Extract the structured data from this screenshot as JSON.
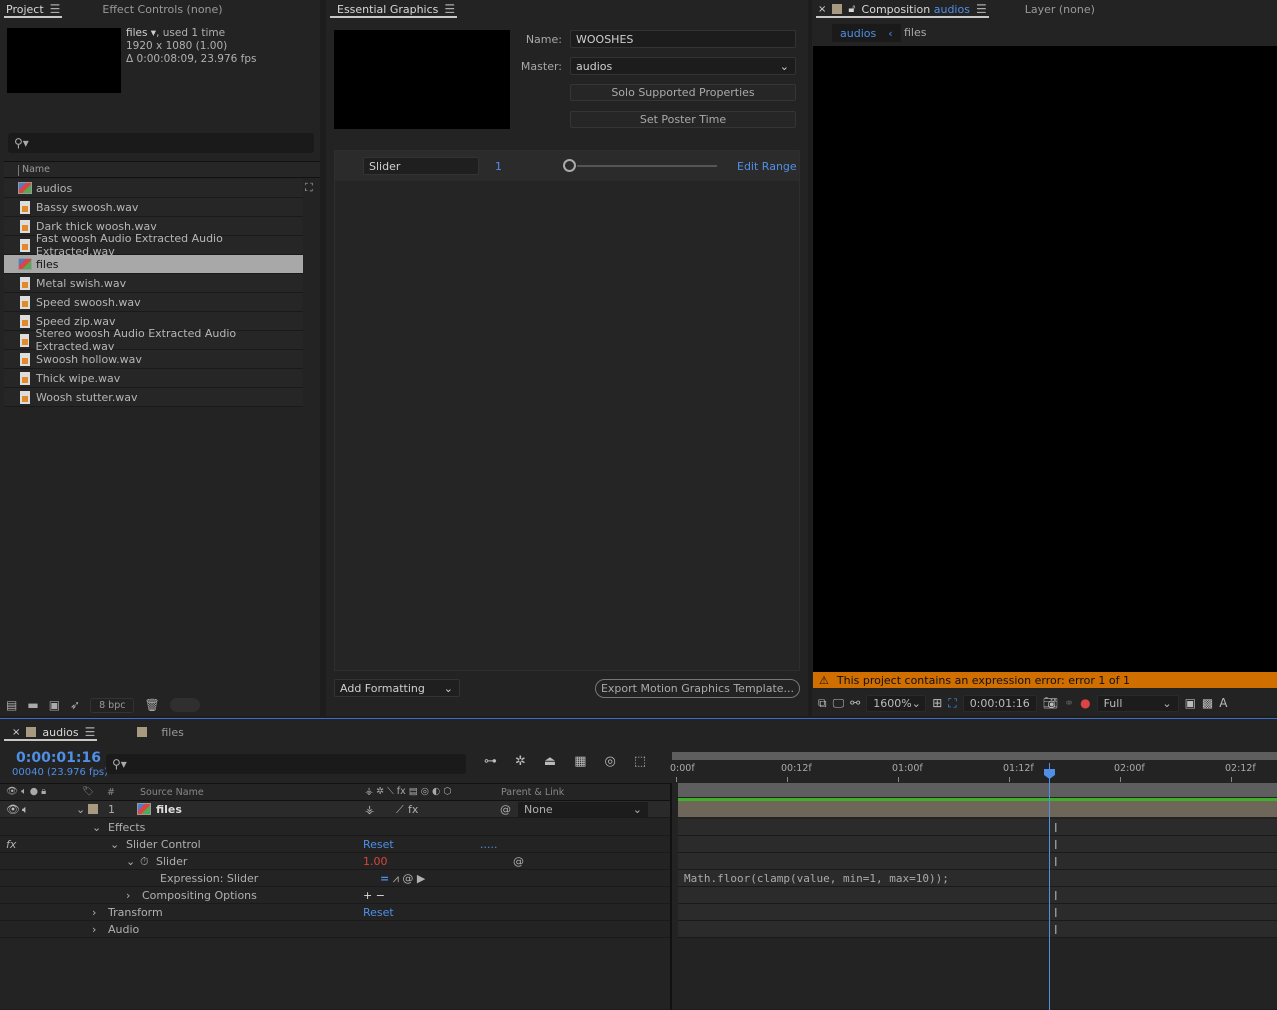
{
  "project": {
    "tabs": [
      {
        "label": "Project",
        "active": true
      },
      {
        "label": "Effect Controls (none)",
        "active": false
      }
    ],
    "info": {
      "name": "files",
      "usage": ", used 1 time",
      "resolution": "1920 x 1080 (1.00)",
      "duration": "Δ 0:00:08:09, 23.976 fps"
    },
    "search_placeholder": "",
    "column_name": "Name",
    "items": [
      {
        "name": "audios",
        "type": "comp",
        "selected": false
      },
      {
        "name": "Bassy swoosh.wav",
        "type": "audio",
        "selected": false
      },
      {
        "name": "Dark thick woosh.wav",
        "type": "audio",
        "selected": false
      },
      {
        "name": "Fast woosh Audio Extracted Audio Extracted.wav",
        "type": "audio",
        "selected": false
      },
      {
        "name": "files",
        "type": "comp",
        "selected": true
      },
      {
        "name": "Metal swish.wav",
        "type": "audio",
        "selected": false
      },
      {
        "name": "Speed swoosh.wav",
        "type": "audio",
        "selected": false
      },
      {
        "name": "Speed zip.wav",
        "type": "audio",
        "selected": false
      },
      {
        "name": "Stereo woosh Audio Extracted Audio Extracted.wav",
        "type": "audio",
        "selected": false
      },
      {
        "name": "Swoosh hollow.wav",
        "type": "audio",
        "selected": false
      },
      {
        "name": "Thick wipe.wav",
        "type": "audio",
        "selected": false
      },
      {
        "name": "Woosh stutter.wav",
        "type": "audio",
        "selected": false
      }
    ],
    "bpc": "8 bpc"
  },
  "essential": {
    "title": "Essential Graphics",
    "name_label": "Name:",
    "name_value": "WOOSHES",
    "master_label": "Master:",
    "master_value": "audios",
    "solo_button": "Solo Supported Properties",
    "poster_button": "Set Poster Time",
    "slider": {
      "name": "Slider",
      "value": "1",
      "edit_range": "Edit Range"
    },
    "add_formatting": "Add Formatting",
    "export_button": "Export Motion Graphics Template..."
  },
  "composition": {
    "tab_prefix": "Composition",
    "tab_name": "audios",
    "layer_tab": "Layer (none)",
    "breadcrumbs": [
      "audios",
      "files"
    ],
    "error": "This project contains an expression error: error 1 of 1",
    "zoom": "1600%",
    "timecode": "0:00:01:16",
    "resolution": "Full",
    "extra": "A"
  },
  "timeline": {
    "tabs": [
      {
        "label": "audios",
        "active": true
      },
      {
        "label": "files",
        "active": false
      }
    ],
    "timecode": "0:00:01:16",
    "frames": "00040 (23.976 fps)",
    "columns": {
      "num": "#",
      "source": "Source Name",
      "parent": "Parent & Link"
    },
    "layer": {
      "num": "1",
      "name": "files",
      "parent": "None"
    },
    "props": [
      {
        "label": "Effects",
        "value": ""
      },
      {
        "label": "Slider Control",
        "value": "Reset",
        "extra": "....."
      },
      {
        "label": "Slider",
        "value": "1.00"
      },
      {
        "label": "Expression: Slider",
        "value": ""
      },
      {
        "label": "Compositing Options",
        "value": "+ −"
      },
      {
        "label": "Transform",
        "value": "Reset"
      },
      {
        "label": "Audio",
        "value": ""
      }
    ],
    "ruler": [
      "0:00f",
      "00:12f",
      "01:00f",
      "01:12f",
      "02:00f",
      "02:12f"
    ],
    "expression": "Math.floor(clamp(value, min=1, max=10));"
  },
  "colors": {
    "accent": "#4f8fe6",
    "error": "#d16e00",
    "value_red": "#d9453c",
    "label_tan": "#a79a80",
    "audio_bar": "#3fae2a"
  }
}
